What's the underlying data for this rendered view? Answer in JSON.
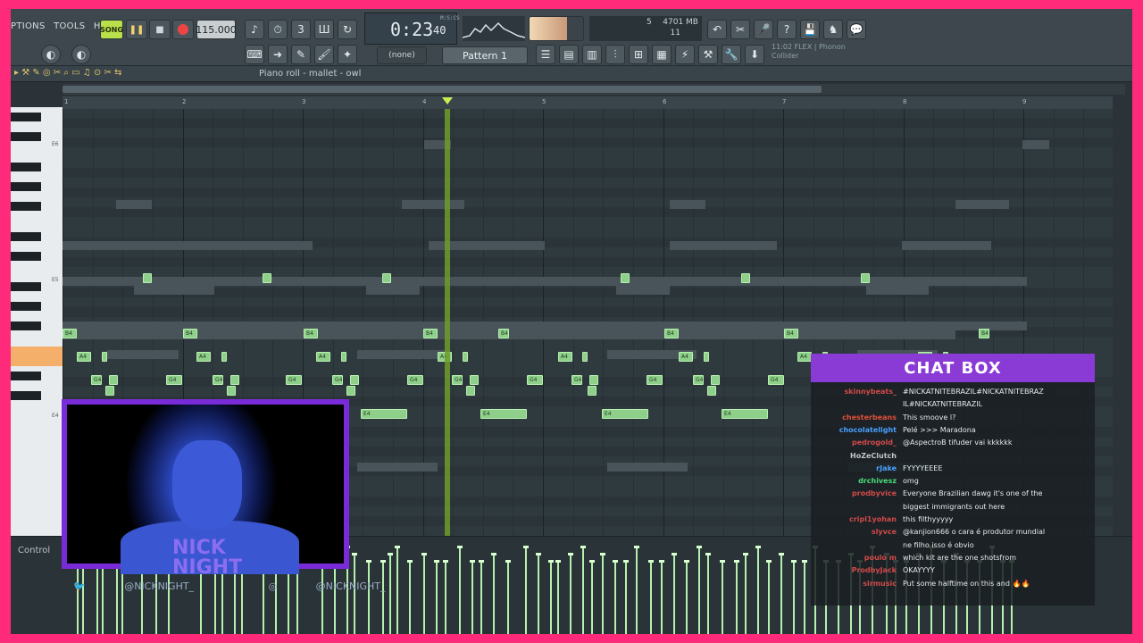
{
  "menu": [
    "PTIONS",
    "TOOLS",
    "HELP"
  ],
  "transport": {
    "song_label": "SONG",
    "tempo": "115.000",
    "time_main": "0:23",
    "time_sub": "40",
    "time_label": "M:S:CS"
  },
  "resources": {
    "memory": "4701 MB",
    "cpu": "5",
    "polyphony": "11"
  },
  "hint": {
    "line1": "11:02  FLEX | Phonon",
    "line2": "Collider"
  },
  "pattern": {
    "name": "Pattern 1",
    "none": "(none)"
  },
  "piano_roll": {
    "title": "Piano roll - mallet - owl",
    "bars": [
      "1",
      "2",
      "3",
      "4",
      "5",
      "6",
      "7",
      "8",
      "9"
    ],
    "key_labels": [
      "E6",
      "E5",
      "E4"
    ],
    "control_label": "Control"
  },
  "notes": [
    {
      "label": "",
      "row": 8
    },
    {
      "label": "B4",
      "row": 11
    },
    {
      "label": "A4",
      "row": 12
    },
    {
      "label": "G4",
      "row": 13
    },
    {
      "label": "E4",
      "row": 15
    }
  ],
  "webcam": {
    "logo_line1": "NICK",
    "logo_line2": "NIGHT",
    "twitter": "@NICKNIGHT_",
    "instagram": "@NICKNIGHT_"
  },
  "chat": {
    "title": "CHAT BOX",
    "messages": [
      {
        "user": "skinnybeats_",
        "text": "#NICKATNITEBRAZIL#NICKATNITEBRAZ",
        "color": "#d24a4a"
      },
      {
        "user": "",
        "text": "IL#NICKATNITEBRAZIL",
        "color": "#d24a4a"
      },
      {
        "user": "chesterbeans",
        "text": "This smoove l?",
        "color": "#e0503a"
      },
      {
        "user": "chocolatelight",
        "text": "Pelé >>> Maradona",
        "color": "#4aa0ff"
      },
      {
        "user": "pedrogold_",
        "text": "@AspectroB tifuder vai kkkkkk",
        "color": "#d24a4a"
      },
      {
        "user": "HoZeClutch",
        "text": "",
        "color": "#c0c6ca"
      },
      {
        "user": "rJake",
        "text": "FYYYYEEEE",
        "color": "#4aa0ff"
      },
      {
        "user": "drchivesz",
        "text": "omg",
        "color": "#4adb7a"
      },
      {
        "user": "prodbyvice",
        "text": "Everyone Brazilian dawg it's one of the",
        "color": "#d24a4a"
      },
      {
        "user": "",
        "text": "biggest immigrants out here",
        "color": "#d24a4a"
      },
      {
        "user": "cripl1yohan",
        "text": "this filthyyyyy",
        "color": "#d24a4a"
      },
      {
        "user": "slyvce",
        "text": "@kanjion666 o cara é produtor mundial",
        "color": "#d24a4a"
      },
      {
        "user": "",
        "text": "ne filho isso é obvio",
        "color": "#d24a4a"
      },
      {
        "user": "poulo m",
        "text": "which kit are the one shotsfrom",
        "color": "#d24a4a"
      },
      {
        "user": "ProdbyJack",
        "text": "OKAYYYY",
        "color": "#d24a4a"
      },
      {
        "user": "sirmusic",
        "text": "Put some halftime on this and 🔥🔥",
        "color": "#d24a4a"
      }
    ]
  }
}
